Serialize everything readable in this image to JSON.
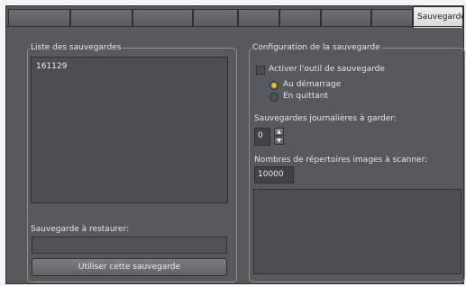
{
  "tabs": {
    "active_label": "Sauvegardes"
  },
  "left_group": {
    "title": "Liste des sauvegardes",
    "items": [
      "161129"
    ],
    "restore_label": "Sauvegarde à restaurer:",
    "restore_value": "",
    "use_button": "Utiliser cette sauvegarde"
  },
  "right_group": {
    "title": "Configuration de la sauvegarde",
    "activate_label": "Activer l'outil de sauvegarde",
    "activate_checked": false,
    "radio_startup": "Au démarrage",
    "radio_quit": "En quittant",
    "radio_selected": "startup",
    "daily_label": "Sauvegardes journalières à garder:",
    "daily_value": "0",
    "dirs_label": "Nombres de répertoires images à scanner:",
    "dirs_value": "10000"
  },
  "icons": {
    "spin_up": "spin-up-arrow-icon",
    "spin_down": "spin-down-arrow-icon"
  }
}
